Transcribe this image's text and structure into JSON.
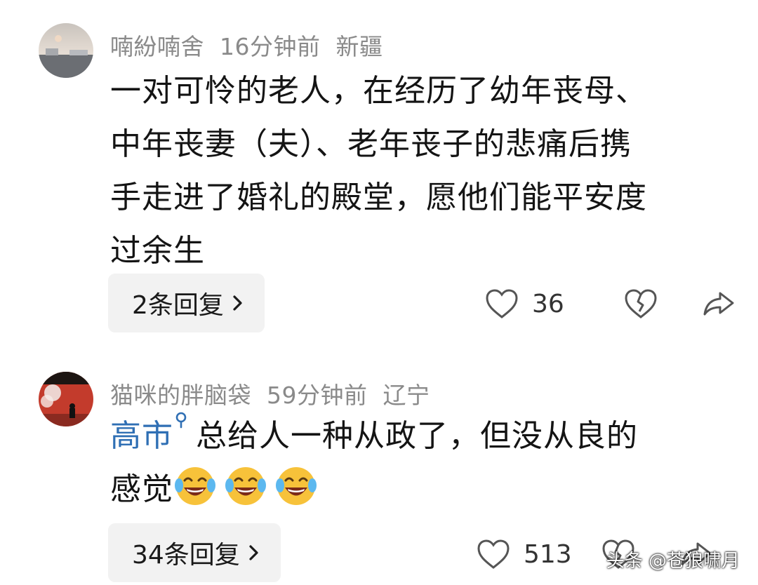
{
  "comments": [
    {
      "username": "喃紛喃舍",
      "time": "16分钟前",
      "location": "新疆",
      "text_lines": [
        "一对可怜的老人，在经历了幼年丧母、",
        "中年丧妻（夫）、老年丧子的悲痛后携",
        "手走进了婚礼的殿堂，愿他们能平安度",
        "过余生"
      ],
      "reply_label": "2条回复",
      "likes": "36"
    },
    {
      "username": "猫咪的胖脑袋",
      "time": "59分钟前",
      "location": "辽宁",
      "mention": "高市",
      "text_first": "总给人一种从政了，但没从良的",
      "text_second": "感觉",
      "emoji_name": "laughing-tears-emoji",
      "reply_label": "34条回复",
      "likes": "513"
    }
  ],
  "watermark": "头条 @苍狼啸月",
  "icons": {
    "like": "heart-outline-icon",
    "dislike": "broken-heart-icon",
    "share": "share-arrow-icon",
    "chevron": "chevron-right-icon",
    "search": "search-icon"
  },
  "colors": {
    "meta_text": "#8a8a8a",
    "mention": "#2f6fb4",
    "button_bg": "#f2f2f2"
  }
}
